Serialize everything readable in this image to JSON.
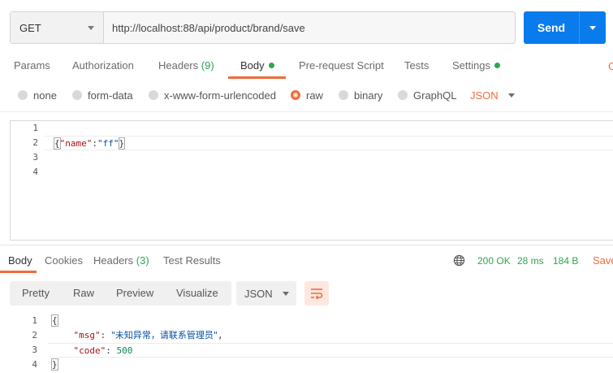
{
  "request": {
    "method": "GET",
    "url": "http://localhost:88/api/product/brand/save",
    "send_label": "Send"
  },
  "request_tabs": [
    {
      "label": "Params"
    },
    {
      "label": "Authorization"
    },
    {
      "label": "Headers",
      "count": "(9)"
    },
    {
      "label": "Body",
      "active": true,
      "dot": true
    },
    {
      "label": "Pre-request Script"
    },
    {
      "label": "Tests"
    },
    {
      "label": "Settings",
      "dot": true
    }
  ],
  "overflow_fragment": "C",
  "body_types": [
    {
      "label": "none"
    },
    {
      "label": "form-data"
    },
    {
      "label": "x-www-form-urlencoded"
    },
    {
      "label": "raw",
      "selected": true
    },
    {
      "label": "binary"
    },
    {
      "label": "GraphQL"
    }
  ],
  "raw_format": "JSON",
  "editor": {
    "line_numbers": [
      "1",
      "2",
      "3",
      "4"
    ],
    "brace_open": "{",
    "key": "\"name\"",
    "colon": ":",
    "value": "\"ff\"",
    "brace_close": "}"
  },
  "response_tabs": [
    {
      "label": "Body",
      "active": true
    },
    {
      "label": "Cookies"
    },
    {
      "label": "Headers",
      "count": "(3)"
    },
    {
      "label": "Test Results"
    }
  ],
  "response_status": {
    "status": "200 OK",
    "time": "28 ms",
    "size": "184 B",
    "save_label": "Save"
  },
  "view_modes": [
    "Pretty",
    "Raw",
    "Preview",
    "Visualize"
  ],
  "response_format": "JSON",
  "response_body": {
    "line_numbers": [
      "1",
      "2",
      "3",
      "4"
    ],
    "open": "{",
    "msg_key": "\"msg\"",
    "msg_value": "\"未知异常，请联系管理员\"",
    "code_key": "\"code\"",
    "code_value": "500",
    "close": "}"
  },
  "colors": {
    "accent": "#f26b3a",
    "send": "#097bed",
    "success": "#2fa550"
  },
  "icons": [
    "caret-down-icon",
    "globe-icon",
    "wrap-lines-icon",
    "radio-icon",
    "status-dot-icon"
  ]
}
